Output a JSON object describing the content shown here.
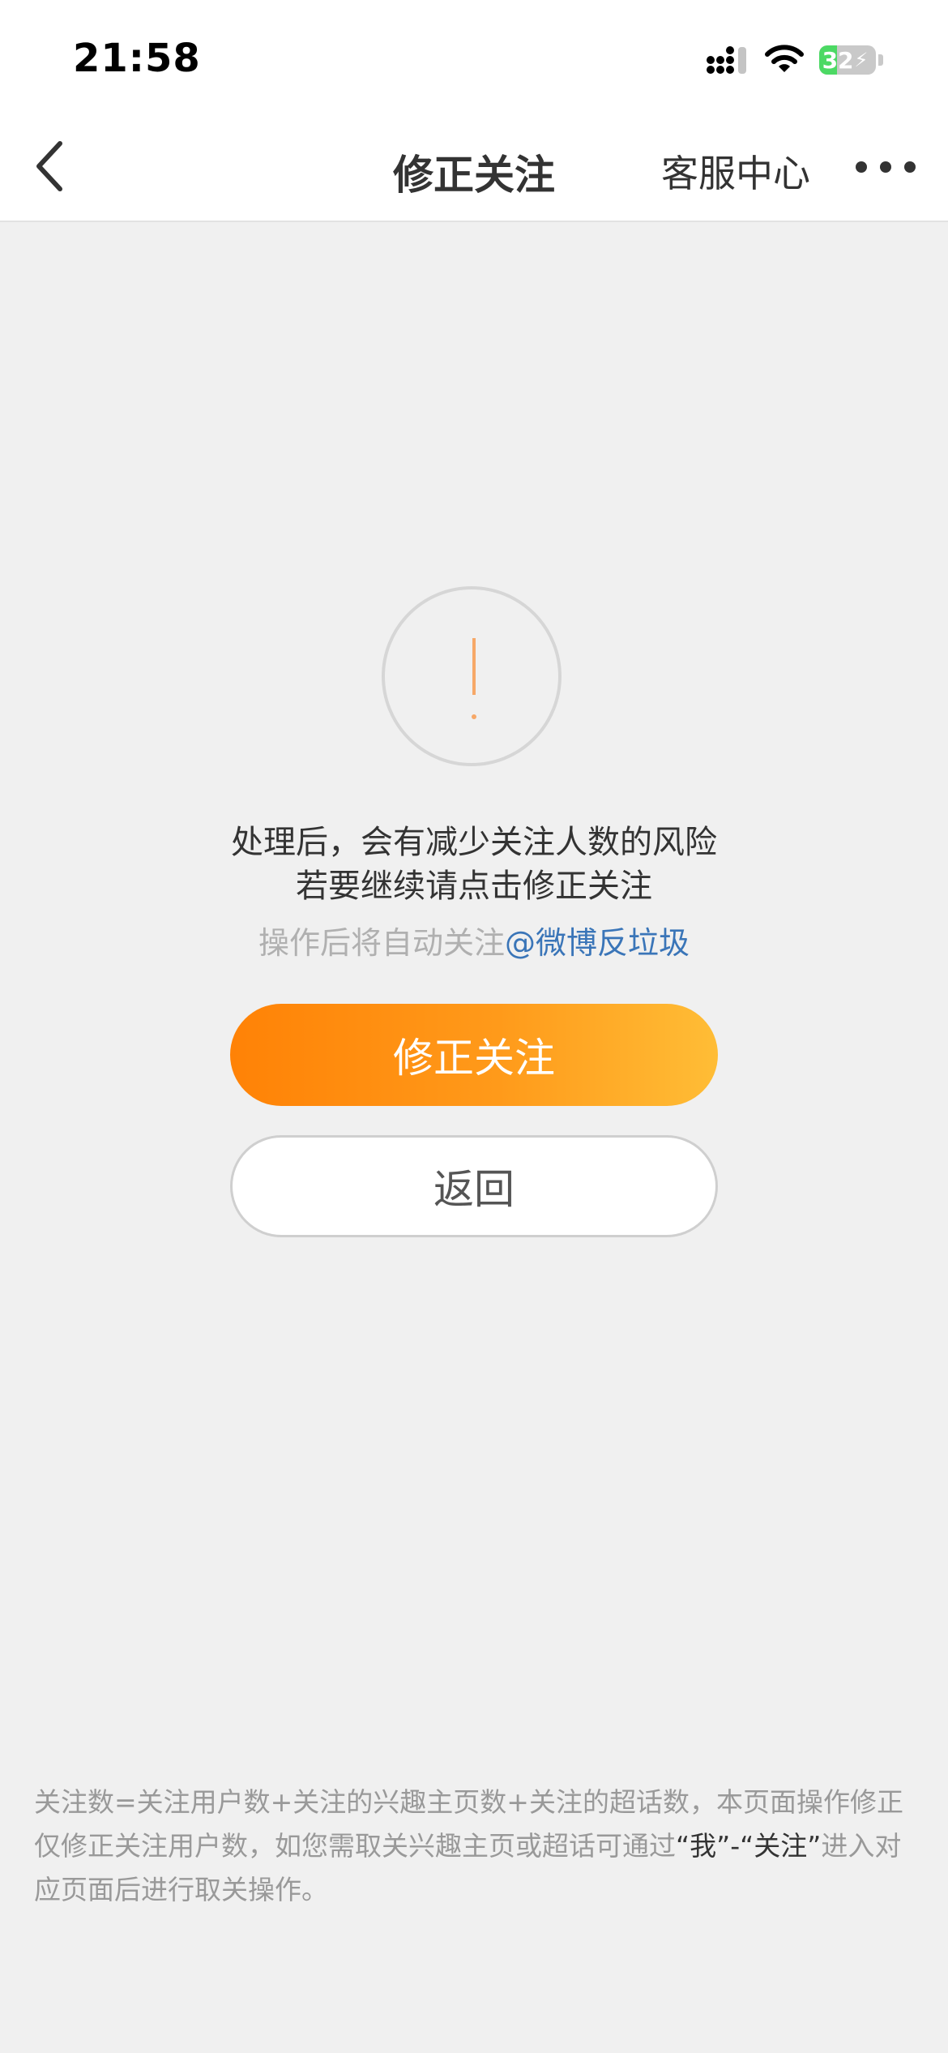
{
  "status_bar": {
    "time": "21:58",
    "battery_level": "32",
    "icons": [
      "signal-icon",
      "wifi-icon",
      "battery-charging-icon"
    ]
  },
  "nav": {
    "back_icon": "chevron-left-icon",
    "title": "修正关注",
    "service_center": "客服中心",
    "more_icon": "more-dots-icon"
  },
  "main": {
    "alert_icon": "exclamation-circle-icon",
    "message_line1": "处理后，会有减少关注人数的风险",
    "message_line2": "若要继续请点击修正关注",
    "auto_follow_prefix": "操作后将自动关注",
    "auto_follow_link": "@微博反垃圾",
    "primary_button": "修正关注",
    "secondary_button": "返回"
  },
  "footnote": {
    "text_before": "关注数=关注用户数+关注的兴趣主页数+关注的超话数，本页面操作修正仅修正关注用户数，如您需取关兴趣主页或超话可通过",
    "quote_me": "“我”",
    "separator": "-",
    "quote_follow": "“关注”",
    "text_after": "进入对应页面后进行取关操作。"
  },
  "colors": {
    "accent_start": "#ff8206",
    "accent_end": "#ffbd36",
    "link": "#3a75b8",
    "background": "#f0f0f0"
  }
}
